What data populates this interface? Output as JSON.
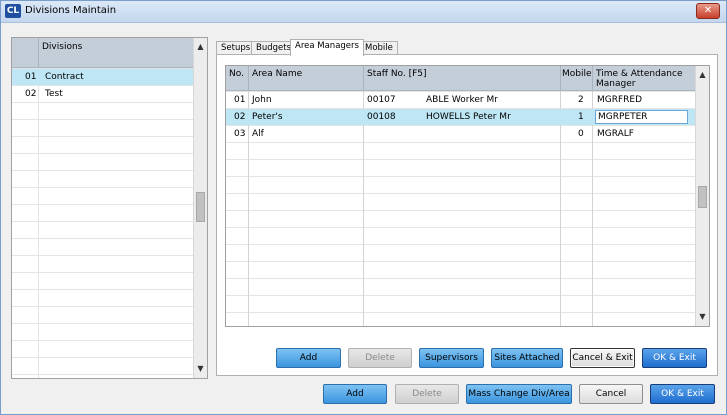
{
  "window": {
    "title": "Divisions Maintain",
    "logo": "CL",
    "close_glyph": "✕"
  },
  "divisions": {
    "header": "Divisions",
    "rows": [
      {
        "num": "01",
        "name": "Contract"
      },
      {
        "num": "02",
        "name": "Test"
      }
    ],
    "selected_index": 0,
    "scroll_up": "▲",
    "scroll_down": "▼"
  },
  "tabs": [
    {
      "label": "Setups"
    },
    {
      "label": "Budgets"
    },
    {
      "label": "Area Managers"
    },
    {
      "label": "Mobile"
    }
  ],
  "active_tab": "Area Managers",
  "area_managers": {
    "columns": {
      "no": "No.",
      "area_name": "Area Name",
      "staff_no": "Staff No. [F5]",
      "mobile": "Mobile",
      "ta_manager": "Time & Attendance Manager"
    },
    "rows": [
      {
        "no": "01",
        "area_name": "John",
        "staff_no": "00107",
        "staff_name": "ABLE Worker Mr",
        "mobile": "2",
        "ta_manager": "MGRFRED"
      },
      {
        "no": "02",
        "area_name": "Peter's",
        "staff_no": "00108",
        "staff_name": "HOWELLS Peter Mr",
        "mobile": "1",
        "ta_manager": "MGRPETER"
      },
      {
        "no": "03",
        "area_name": "Alf",
        "staff_no": "",
        "staff_name": "",
        "mobile": "0",
        "ta_manager": "MGRALF"
      }
    ],
    "selected_index": 1,
    "editing_cell": "ta_manager"
  },
  "tab_buttons": {
    "add": "Add",
    "delete": "Delete",
    "supervisors": "Supervisors",
    "sites_attached": "Sites Attached",
    "cancel_exit": "Cancel & Exit",
    "ok_exit": "OK & Exit"
  },
  "bottom_buttons": {
    "add": "Add",
    "delete": "Delete",
    "mass_change": "Mass Change Div/Area",
    "cancel": "Cancel",
    "ok_exit": "OK & Exit"
  },
  "colors": {
    "selection": "#bfe6f4",
    "header": "#c3ced9",
    "button_blue": "#3a95df"
  }
}
